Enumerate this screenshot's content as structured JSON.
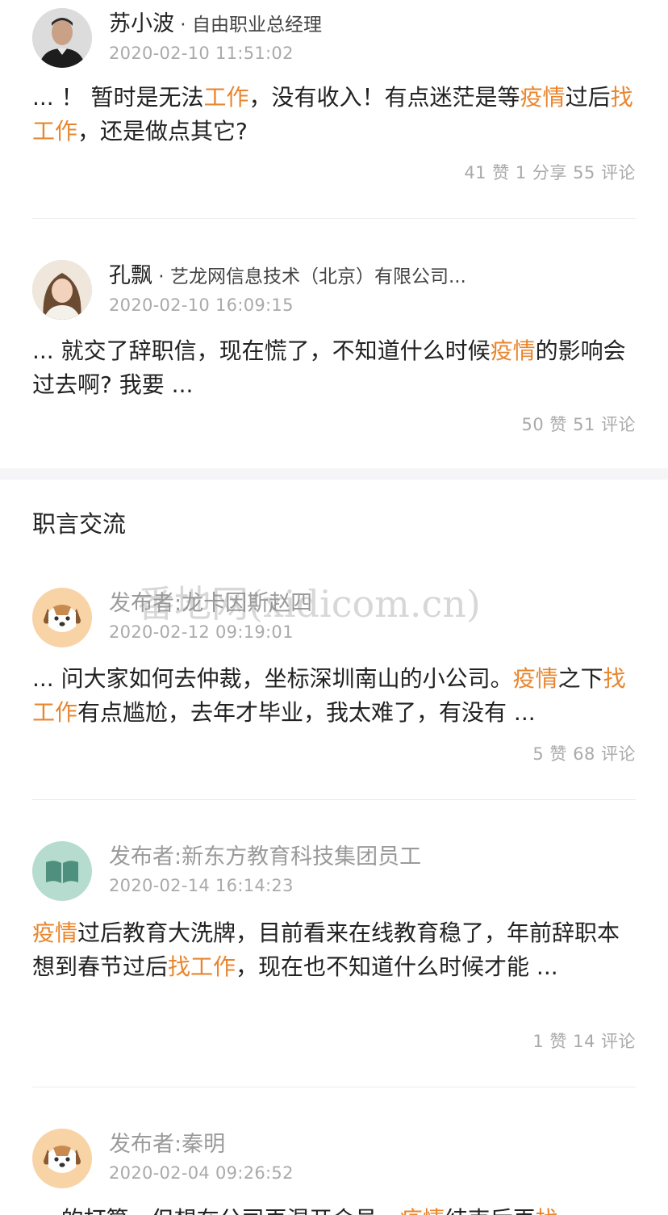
{
  "posts_top": [
    {
      "name": "苏小波",
      "title": "自由职业总经理",
      "time": "2020-02-10 11:51:02",
      "body_segments": [
        {
          "t": "... ！ 暂时是无法",
          "hl": false
        },
        {
          "t": "工作",
          "hl": true
        },
        {
          "t": "，没有收入！有点迷茫是等",
          "hl": false
        },
        {
          "t": "疫情",
          "hl": true
        },
        {
          "t": "过后",
          "hl": false
        },
        {
          "t": "找工作",
          "hl": true
        },
        {
          "t": "，还是做点其它?",
          "hl": false
        }
      ],
      "stats": "41 赞 1 分享 55 评论"
    },
    {
      "name": "孔飘",
      "title": "艺龙网信息技术（北京）有限公司...",
      "time": "2020-02-10 16:09:15",
      "body_segments": [
        {
          "t": "... 就交了辞职信，现在慌了，不知道什么时候",
          "hl": false
        },
        {
          "t": "疫情",
          "hl": true
        },
        {
          "t": "的影响会过去啊? 我要 ...",
          "hl": false
        }
      ],
      "stats": "50 赞 51 评论"
    }
  ],
  "section": {
    "title": "职言交流"
  },
  "watermark": "番地网(xidicom.cn)",
  "posts_forum": [
    {
      "author": "发布者:龙卡因斯赵四",
      "time": "2020-02-12 09:19:01",
      "avatar_icon": "dog-icon",
      "body_segments": [
        {
          "t": "... 问大家如何去仲裁，坐标深圳南山的小公司。",
          "hl": false
        },
        {
          "t": "疫情",
          "hl": true
        },
        {
          "t": "之下",
          "hl": false
        },
        {
          "t": "找工作",
          "hl": true
        },
        {
          "t": "有点尴尬，去年才毕业，我太难了，有没有 ...",
          "hl": false
        }
      ],
      "stats": "5 赞 68 评论"
    },
    {
      "author": "发布者:新东方教育科技集团员工",
      "time": "2020-02-14 16:14:23",
      "avatar_icon": "book-icon",
      "body_segments": [
        {
          "t": "疫情",
          "hl": true
        },
        {
          "t": "过后教育大洗牌，目前看来在线教育稳了，年前辞职本想到春节过后",
          "hl": false
        },
        {
          "t": "找工作",
          "hl": true
        },
        {
          "t": "，现在也不知道什么时候才能 ...",
          "hl": false
        }
      ],
      "stats": "1 赞 14 评论"
    },
    {
      "author": "发布者:秦明",
      "time": "2020-02-04 09:26:52",
      "avatar_icon": "dog-icon",
      "body_segments": [
        {
          "t": "... 的打算，但想在公司再混开会员，",
          "hl": false
        },
        {
          "t": "疫情",
          "hl": true
        },
        {
          "t": "结束后再",
          "hl": false
        },
        {
          "t": "找",
          "hl": true
        }
      ],
      "stats": ""
    }
  ],
  "colors": {
    "highlight": "#e8862f",
    "meta_gray": "#aaaaaa",
    "dog_bg": "#f8d3a6",
    "book_bg": "#b5dccf"
  }
}
